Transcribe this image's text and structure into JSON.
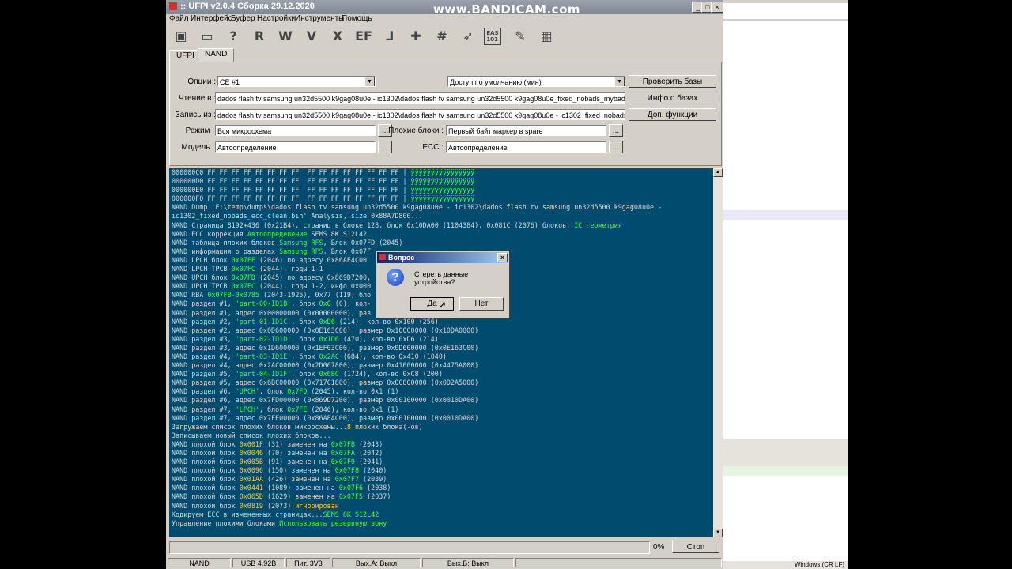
{
  "watermark": "www.BANDICAM.com",
  "window": {
    "title": ":: UFPI v2.0.4 Сборка 29.12.2020",
    "min": "_",
    "max": "□",
    "close": "×"
  },
  "menu": [
    "Файл",
    "Интерфейс",
    "Буфер",
    "Настройки",
    "Инструменты",
    "Помощь"
  ],
  "toolbar": {
    "icons": [
      "save-icon",
      "open-folder-icon",
      "query-icon",
      "read-icon",
      "write-icon",
      "verify-icon",
      "erase-icon",
      "ef-icon",
      "blank-check-icon",
      "plus-tool-icon",
      "hash-icon",
      "pin-icon",
      "eas-101-icon",
      "edit-icon",
      "grid-icon"
    ],
    "glyphs": [
      "▣",
      "▭",
      "?",
      "R",
      "W",
      "V",
      "X",
      "EF",
      "⅃",
      "✚",
      "#",
      "➶",
      "EAS\n101",
      "✎",
      "▦"
    ]
  },
  "tabs": [
    "UFPI",
    "NAND"
  ],
  "form": {
    "options_label": "Опции :",
    "options_value": "CE #1",
    "access_value": "Доступ по умолчанию (мин)",
    "read_label": "Чтение в :",
    "read_value": "dados flash tv samsung un32d5500 k9gag08u0e - ic1302\\dados flash tv samsung un32d5500 k9gag08u0e_fixed_nobads_mybads_ecc_clean1.ntt",
    "write_label": "Запись из :",
    "write_value": "dados flash tv samsung un32d5500 k9gag08u0e - ic1302\\dados flash tv samsung un32d5500 k9gag08u0e - ic1302_fixed_nobads_ecc_clean.bin",
    "mode_label": "Режим :",
    "mode_value": "Вся микросхема",
    "bad_label": "Плохие блоки :",
    "bad_value": "Первый байт маркер в spare",
    "model_label": "Модель :",
    "model_value": "Автоопределение",
    "ecc_label": "ECC :",
    "ecc_value": "Автоопределение",
    "dots": "...",
    "btn_check_db": "Проверить базы",
    "btn_db_info": "Инфо о базах",
    "btn_extra": "Доп. функции"
  },
  "log": [
    [
      [
        "000000C0 FF FF FF FF FF FF FF FF  FF FF FF FF FF FF FF FF | ",
        ""
      ],
      [
        "ÿÿÿÿÿÿÿÿÿÿÿÿÿÿÿÿ",
        "g"
      ]
    ],
    [
      [
        "000000D0 FF FF FF FF FF FF FF FF  FF FF FF FF FF FF FF FF | ",
        ""
      ],
      [
        "ÿÿÿÿÿÿÿÿÿÿÿÿÿÿÿÿ",
        "g"
      ]
    ],
    [
      [
        "000000E0 FF FF FF FF FF FF FF FF  FF FF FF FF FF FF FF FF | ",
        ""
      ],
      [
        "ÿÿÿÿÿÿÿÿÿÿÿÿÿÿÿÿ",
        "g"
      ]
    ],
    [
      [
        "000000F0 FF FF FF FF FF FF FF FF  FF FF FF FF FF FF FF FF | ",
        ""
      ],
      [
        "ÿÿÿÿÿÿÿÿÿÿÿÿÿÿÿÿ",
        "g"
      ]
    ],
    [
      [
        "NAND Dump 'E:\\temp\\dumps\\dados flash tv samsung un32d5500 k9gag08u0e - ic1302\\dados flash tv samsung un32d5500 k9gag08u0e -",
        ""
      ]
    ],
    [
      [
        "ic1302_fixed_nobads_ecc_clean.bin' Analysis, size 0x88A7D800...",
        ""
      ]
    ],
    [
      [
        "NAND Страница 8192+436 (0x21B4), страниц в блоке 128, блок 0x10DA00 (1104384), 0x081C (2076) блоков, ",
        ""
      ],
      [
        "IC геометрия",
        "g"
      ]
    ],
    [
      [
        "NAND ECC коррекция ",
        ""
      ],
      [
        "Автоопределение",
        "g"
      ],
      [
        " SEMS 8K S12L42",
        ""
      ]
    ],
    [
      [
        "NAND таблица плохих блоков ",
        ""
      ],
      [
        "Samsung RFS",
        "g"
      ],
      [
        ", Блок 0x07FD (2045)",
        ""
      ]
    ],
    [
      [
        "NAND информация о разделах ",
        ""
      ],
      [
        "Samsung RFS",
        "g"
      ],
      [
        ", Блок 0x07F",
        ""
      ]
    ],
    [
      [
        "NAND LPCH блок ",
        ""
      ],
      [
        "0x07FE",
        "g"
      ],
      [
        " (2046) по адресу 0x86AE4C00",
        ""
      ]
    ],
    [
      [
        "NAND LPCH TPCB ",
        ""
      ],
      [
        "0x07FC",
        "g"
      ],
      [
        " (2044), годы 1-1",
        ""
      ]
    ],
    [
      [
        "NAND UPCH блок ",
        ""
      ],
      [
        "0x07FD",
        "g"
      ],
      [
        " (2045) по адресу 0x869D7200,",
        ""
      ]
    ],
    [
      [
        "NAND UPCH TPCB ",
        ""
      ],
      [
        "0x07FC",
        "g"
      ],
      [
        " (2044), годы 1-2, инфо 0x000",
        ""
      ]
    ],
    [
      [
        "NAND RBA ",
        ""
      ],
      [
        "0x07FB-0x0785",
        "g"
      ],
      [
        " (2043-1925), 0x77 (119) бло",
        ""
      ]
    ],
    [
      [
        "NAND раздел #1, ",
        ""
      ],
      [
        "'part-00-ID1B'",
        "g"
      ],
      [
        ", блок ",
        ""
      ],
      [
        "0x0",
        "g"
      ],
      [
        " (0), кол-",
        ""
      ]
    ],
    [
      [
        "NAND раздел #1, адрес 0x00000000 (0x00000000), раз",
        ""
      ]
    ],
    [
      [
        "NAND раздел #2, ",
        ""
      ],
      [
        "'part-01-ID1C'",
        "g"
      ],
      [
        ", блок ",
        ""
      ],
      [
        "0xD6",
        "g"
      ],
      [
        " (214), кол-во 0x100 (256)",
        ""
      ]
    ],
    [
      [
        "NAND раздел #2, адрес 0x0D600000 (0x0E163C00), размер 0x10000000 (0x10DA0000)",
        ""
      ]
    ],
    [
      [
        "NAND раздел #3, ",
        ""
      ],
      [
        "'part-02-ID1D'",
        "g"
      ],
      [
        ", блок ",
        ""
      ],
      [
        "0x1D6",
        "g"
      ],
      [
        " (470), кол-во 0xD6 (214)",
        ""
      ]
    ],
    [
      [
        "NAND раздел #3, адрес 0x1D600000 (0x1EF03C00), размер 0x0D600000 (0x0E163C00)",
        ""
      ]
    ],
    [
      [
        "NAND раздел #4, ",
        ""
      ],
      [
        "'part-03-ID1E'",
        "g"
      ],
      [
        ", блок ",
        ""
      ],
      [
        "0x2AC",
        "g"
      ],
      [
        " (684), кол-во 0x410 (1040)",
        ""
      ]
    ],
    [
      [
        "NAND раздел #4, адрес 0x2AC00000 (0x2D067800), размер 0x41000000 (0x4475A000)",
        ""
      ]
    ],
    [
      [
        "NAND раздел #5, ",
        ""
      ],
      [
        "'part-04-ID1F'",
        "g"
      ],
      [
        ", блок ",
        ""
      ],
      [
        "0x6BC",
        "g"
      ],
      [
        " (1724), кол-во 0xC8 (200)",
        ""
      ]
    ],
    [
      [
        "NAND раздел #5, адрес 0x6BC00000 (0x717C1800), размер 0x0C800000 (0x0D2A5000)",
        ""
      ]
    ],
    [
      [
        "NAND раздел #6, ",
        ""
      ],
      [
        "'UPCH'",
        "g"
      ],
      [
        ", блок ",
        ""
      ],
      [
        "0x7FD",
        "g"
      ],
      [
        " (2045), кол-во 0x1 (1)",
        ""
      ]
    ],
    [
      [
        "NAND раздел #6, адрес 0x7FD00000 (0x869D7200), размер 0x00100000 (0x0010DA00)",
        ""
      ]
    ],
    [
      [
        "NAND раздел #7, ",
        ""
      ],
      [
        "'LPCH'",
        "g"
      ],
      [
        ", блок ",
        ""
      ],
      [
        "0x7FE",
        "g"
      ],
      [
        " (2046), кол-во 0x1 (1)",
        ""
      ]
    ],
    [
      [
        "NAND раздел #7, адрес 0x7FE00000 (0x86AE4C00), размер 0x00100000 (0x0010DA00)",
        ""
      ]
    ],
    [
      [
        "Загружаем список плохих блоков микросхемы...",
        ""
      ],
      [
        "8",
        "y"
      ],
      [
        " плохих блока(-ов)",
        ""
      ]
    ],
    [
      [
        "Записываем новый список плохих блоков...",
        ""
      ]
    ],
    [
      [
        "NAND плохой блок ",
        ""
      ],
      [
        "0x001F",
        "y"
      ],
      [
        " (31) заменен на ",
        ""
      ],
      [
        "0x07FB",
        "g"
      ],
      [
        " (2043)",
        ""
      ]
    ],
    [
      [
        "NAND плохой блок ",
        ""
      ],
      [
        "0x0046",
        "y"
      ],
      [
        " (70) заменен на ",
        ""
      ],
      [
        "0x07FA",
        "g"
      ],
      [
        " (2042)",
        ""
      ]
    ],
    [
      [
        "NAND плохой блок ",
        ""
      ],
      [
        "0x005B",
        "y"
      ],
      [
        " (91) заменен на ",
        ""
      ],
      [
        "0x07F9",
        "g"
      ],
      [
        " (2041)",
        ""
      ]
    ],
    [
      [
        "NAND плохой блок ",
        ""
      ],
      [
        "0x0096",
        "y"
      ],
      [
        " (150) заменен на ",
        ""
      ],
      [
        "0x07F8",
        "g"
      ],
      [
        " (2040)",
        ""
      ]
    ],
    [
      [
        "NAND плохой блок ",
        ""
      ],
      [
        "0x01AA",
        "y"
      ],
      [
        " (426) заменен на ",
        ""
      ],
      [
        "0x07F7",
        "g"
      ],
      [
        " (2039)",
        ""
      ]
    ],
    [
      [
        "NAND плохой блок ",
        ""
      ],
      [
        "0x0441",
        "y"
      ],
      [
        " (1089) заменен на ",
        ""
      ],
      [
        "0x07F6",
        "g"
      ],
      [
        " (2038)",
        ""
      ]
    ],
    [
      [
        "NAND плохой блок ",
        ""
      ],
      [
        "0x065D",
        "y"
      ],
      [
        " (1629) заменен на ",
        ""
      ],
      [
        "0x07F5",
        "g"
      ],
      [
        " (2037)",
        ""
      ]
    ],
    [
      [
        "NAND плохой блок ",
        ""
      ],
      [
        "0x0819",
        "y"
      ],
      [
        " (2073) ",
        ""
      ],
      [
        "игнорирован",
        "y"
      ]
    ],
    [
      [
        "Кодируем ECC в измененных страницах...",
        ""
      ],
      [
        "SEMS 8K S12L42",
        "g"
      ]
    ],
    [
      [
        "Управление плохими блоками ",
        ""
      ],
      [
        "Использовать резервную зону",
        "g"
      ]
    ]
  ],
  "progress": {
    "percent_label": "0%",
    "value": 0,
    "stop_label": "Стоп"
  },
  "status": [
    "NAND",
    "USB 4.92В",
    "Пит. 3V3",
    "Вых.А: Выкл",
    "Вых.Б: Выкл"
  ],
  "dialog": {
    "title": "Вопрос",
    "message": "Стереть данные устройства?",
    "yes": "Да",
    "no": "Нет",
    "close": "×"
  },
  "right_panel": {
    "footer": "Windows (CR LF)"
  },
  "colors": {
    "log_bg": "#004b6e",
    "log_green": "#3dff3d",
    "log_yellow": "#ffcc33",
    "dialog_title": "#0a246a"
  }
}
